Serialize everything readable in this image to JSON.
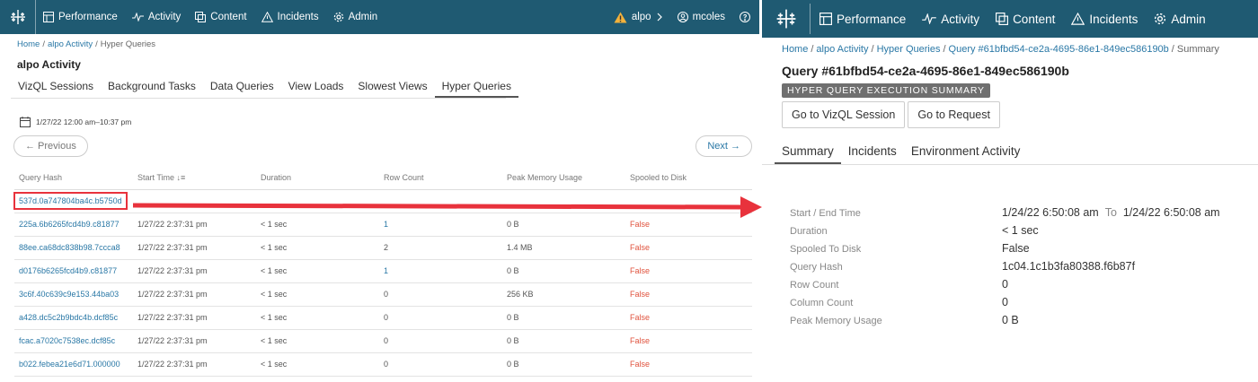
{
  "left": {
    "nav": {
      "performance": "Performance",
      "activity": "Activity",
      "content": "Content",
      "incidents": "Incidents",
      "admin": "Admin",
      "site": "alpo",
      "user": "mcoles"
    },
    "breadcrumb": {
      "home": "Home",
      "activity": "alpo Activity",
      "current": "Hyper Queries"
    },
    "title": "alpo Activity",
    "tabs": [
      "VizQL Sessions",
      "Background Tasks",
      "Data Queries",
      "View Loads",
      "Slowest Views",
      "Hyper Queries"
    ],
    "active_tab": "Hyper Queries",
    "date_range": "1/27/22 12:00 am–10:37 pm",
    "previous": "← Previous",
    "next": "Next →",
    "columns": [
      "Query Hash",
      "Start Time ↓≡",
      "Duration",
      "Row Count",
      "Peak Memory Usage",
      "Spooled to Disk"
    ],
    "rows": [
      {
        "hash": "537d.0a747804ba4c.b5750d",
        "start": "",
        "duration": "",
        "rows": "",
        "memory": "",
        "spooled": ""
      },
      {
        "hash": "225a.6b6265fcd4b9.c81877",
        "start": "1/27/22 2:37:31 pm",
        "duration": "< 1 sec",
        "rows": "1",
        "memory": "0 B",
        "spooled": "False"
      },
      {
        "hash": "88ee.ca68dc838b98.7ccca8",
        "start": "1/27/22 2:37:31 pm",
        "duration": "< 1 sec",
        "rows": "2",
        "memory": "1.4 MB",
        "spooled": "False"
      },
      {
        "hash": "d0176b6265fcd4b9.c81877",
        "start": "1/27/22 2:37:31 pm",
        "duration": "< 1 sec",
        "rows": "1",
        "memory": "0 B",
        "spooled": "False"
      },
      {
        "hash": "3c6f.40c639c9e153.44ba03",
        "start": "1/27/22 2:37:31 pm",
        "duration": "< 1 sec",
        "rows": "0",
        "memory": "256 KB",
        "spooled": "False"
      },
      {
        "hash": "a428.dc5c2b9bdc4b.dcf85c",
        "start": "1/27/22 2:37:31 pm",
        "duration": "< 1 sec",
        "rows": "0",
        "memory": "0 B",
        "spooled": "False"
      },
      {
        "hash": "fcac.a7020c7538ec.dcf85c",
        "start": "1/27/22 2:37:31 pm",
        "duration": "< 1 sec",
        "rows": "0",
        "memory": "0 B",
        "spooled": "False"
      },
      {
        "hash": "b022.febea21e6d71.000000",
        "start": "1/27/22 2:37:31 pm",
        "duration": "< 1 sec",
        "rows": "0",
        "memory": "0 B",
        "spooled": "False"
      }
    ]
  },
  "right": {
    "nav": {
      "performance": "Performance",
      "activity": "Activity",
      "content": "Content",
      "incidents": "Incidents",
      "admin": "Admin"
    },
    "breadcrumb": {
      "home": "Home",
      "activity": "alpo Activity",
      "hyper": "Hyper Queries",
      "query": "Query #61bfbd54-ce2a-4695-86e1-849ec586190b",
      "current": "Summary"
    },
    "title": "Query #61bfbd54-ce2a-4695-86e1-849ec586190b",
    "badge": "HYPER QUERY EXECUTION SUMMARY",
    "buttons": {
      "vizql": "Go to VizQL Session",
      "request": "Go to Request"
    },
    "tabs": [
      "Summary",
      "Incidents",
      "Environment Activity"
    ],
    "active_tab": "Summary",
    "details": {
      "start_end_label": "Start / End Time",
      "start": "1/24/22 6:50:08 am",
      "to": "To",
      "end": "1/24/22 6:50:08 am",
      "duration_label": "Duration",
      "duration": "< 1 sec",
      "spooled_label": "Spooled To Disk",
      "spooled": "False",
      "hash_label": "Query Hash",
      "hash": "1c04.1c1b3fa80388.f6b87f",
      "row_count_label": "Row Count",
      "row_count": "0",
      "column_count_label": "Column Count",
      "column_count": "0",
      "memory_label": "Peak Memory Usage",
      "memory": "0 B"
    }
  },
  "colors": {
    "header": "#1f5a72",
    "link": "#2a78a6",
    "false_text": "#e0533e",
    "arrow": "#e8323c"
  }
}
